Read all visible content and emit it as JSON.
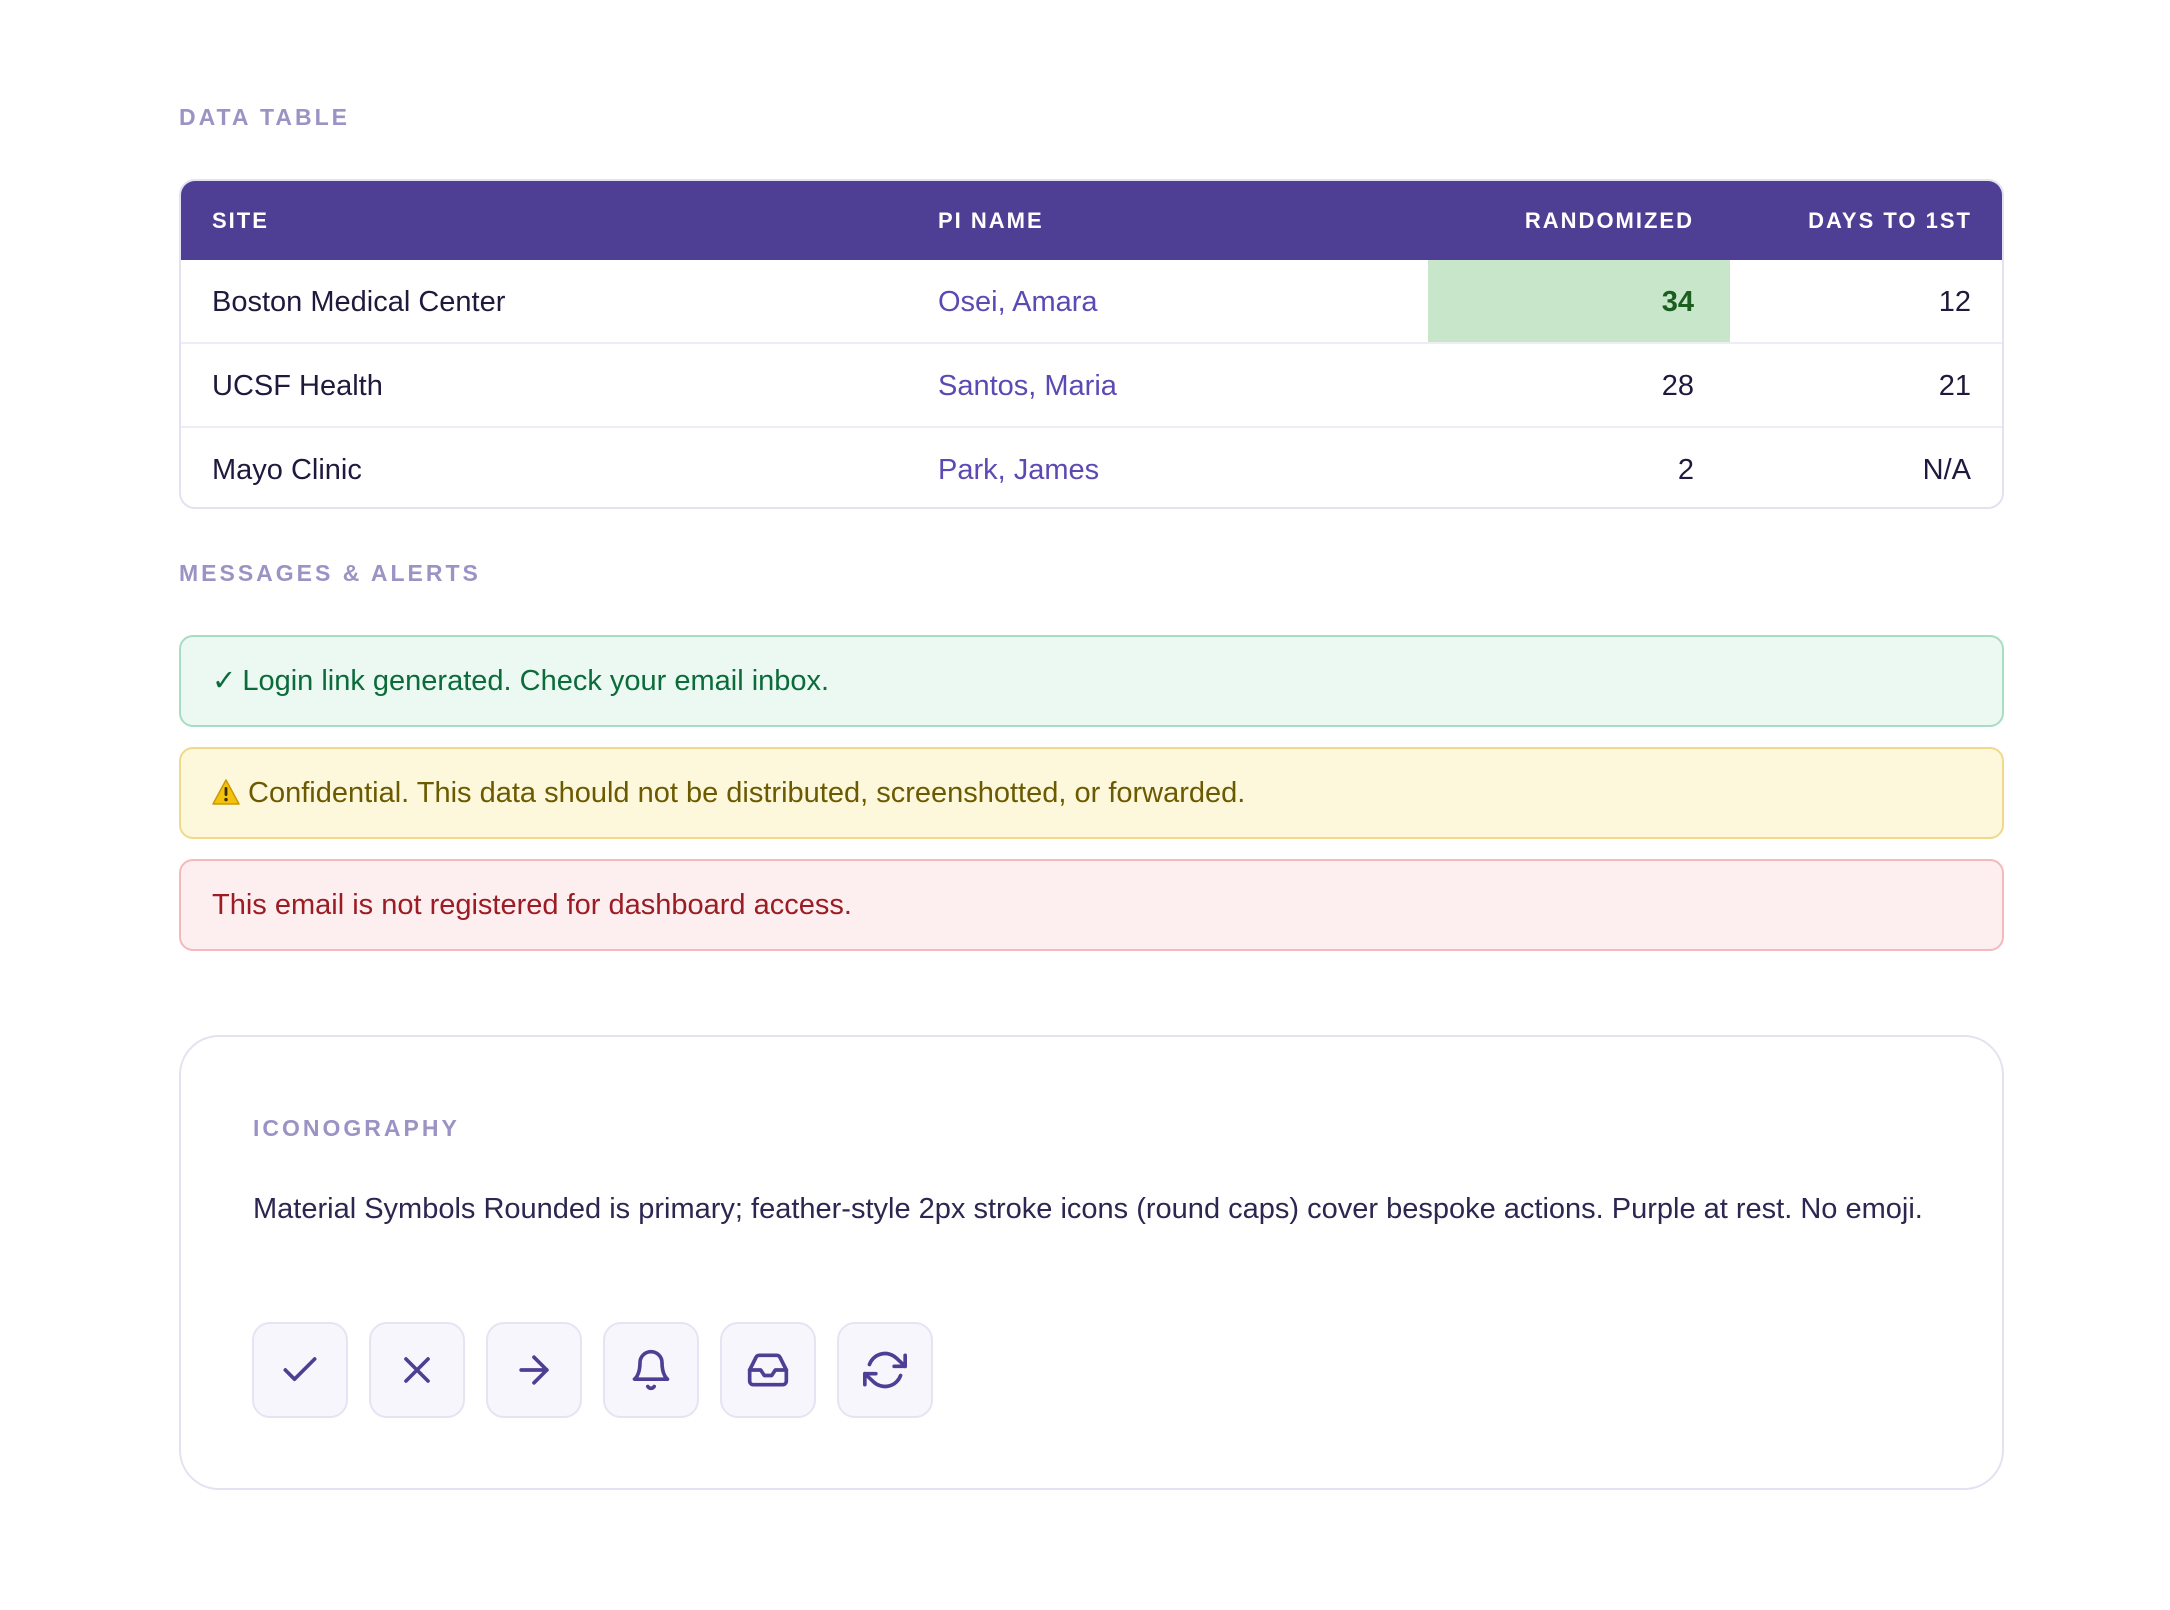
{
  "data_table": {
    "section_label": "DATA TABLE",
    "columns": [
      "SITE",
      "PI NAME",
      "RANDOMIZED",
      "DAYS TO 1ST"
    ],
    "rows": [
      {
        "site": "Boston Medical Center",
        "pi": "Osei, Amara",
        "randomized": "34",
        "days": "12",
        "highlight": true
      },
      {
        "site": "UCSF Health",
        "pi": "Santos, Maria",
        "randomized": "28",
        "days": "21",
        "highlight": false
      },
      {
        "site": "Mayo Clinic",
        "pi": "Park, James",
        "randomized": "2",
        "days": "N/A",
        "highlight": false
      }
    ],
    "colors": {
      "header_bg": "#4f3f94",
      "highlight_bg": "#c8e6c9",
      "highlight_text": "#1b5e20",
      "pi_text": "#5d49b4"
    }
  },
  "alerts": {
    "section_label": "MESSAGES & ALERTS",
    "success": {
      "glyph": "✓",
      "text": "Login link generated. Check your email inbox."
    },
    "warning": {
      "icon": "warning-triangle-icon",
      "text": "Confidential. This data should not be distributed, screenshotted, or forwarded."
    },
    "error": {
      "text": "This email is not registered for dashboard access."
    }
  },
  "iconography": {
    "section_label": "ICONOGRAPHY",
    "description": "Material Symbols Rounded is primary; feather-style 2px stroke icons (round caps) cover bespoke actions. Purple at rest. No emoji.",
    "icons": [
      "check-icon",
      "close-icon",
      "arrow-right-icon",
      "bell-icon",
      "inbox-icon",
      "refresh-icon"
    ],
    "icon_color": "#4f3f94"
  }
}
